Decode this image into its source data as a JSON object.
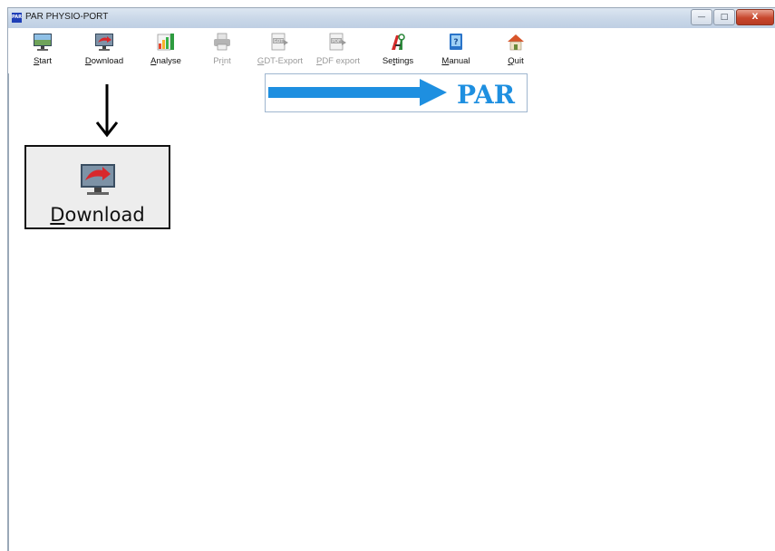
{
  "window": {
    "app_icon_text": "PAR",
    "title": "PAR PHYSIO-PORT",
    "controls": {
      "minimize": "—",
      "maximize": "□",
      "close": "X"
    }
  },
  "toolbar": {
    "items": [
      {
        "name": "Start",
        "mnemonic": "S",
        "rest": "tart",
        "icon": "monitor-landscape-icon",
        "enabled": true
      },
      {
        "name": "Download",
        "mnemonic": "D",
        "rest": "ownload",
        "icon": "monitor-download-icon",
        "enabled": true
      },
      {
        "name": "Analyse",
        "mnemonic": "A",
        "rest": "nalyse",
        "icon": "bar-chart-icon",
        "enabled": true
      },
      {
        "name": "Print",
        "pre": "Pr",
        "mnemonic": "i",
        "rest": "nt",
        "icon": "printer-icon",
        "enabled": false
      },
      {
        "name": "GDT-Export",
        "mnemonic": "G",
        "rest": "DT-Export",
        "icon": "gdt-export-icon",
        "enabled": false
      },
      {
        "name": "PDF export",
        "mnemonic": "P",
        "rest": "DF export",
        "icon": "pdf-export-icon",
        "enabled": false
      },
      {
        "name": "Settings",
        "pre": "Se",
        "mnemonic": "t",
        "rest": "tings",
        "icon": "tools-icon",
        "enabled": true
      },
      {
        "name": "Manual",
        "mnemonic": "M",
        "rest": "anual",
        "icon": "help-book-icon",
        "enabled": true
      },
      {
        "name": "Quit",
        "mnemonic": "Q",
        "rest": "uit",
        "icon": "house-icon",
        "enabled": true
      }
    ]
  },
  "logo": {
    "text": "PAR",
    "color": "#1e8fe0"
  },
  "callout": {
    "mnemonic": "D",
    "rest": "ownload",
    "icon": "monitor-download-icon",
    "arrow": "down-arrow"
  },
  "colors": {
    "accent_blue": "#1e8fe0",
    "disabled_text": "#9a9a9a",
    "download_red": "#d8282c"
  }
}
